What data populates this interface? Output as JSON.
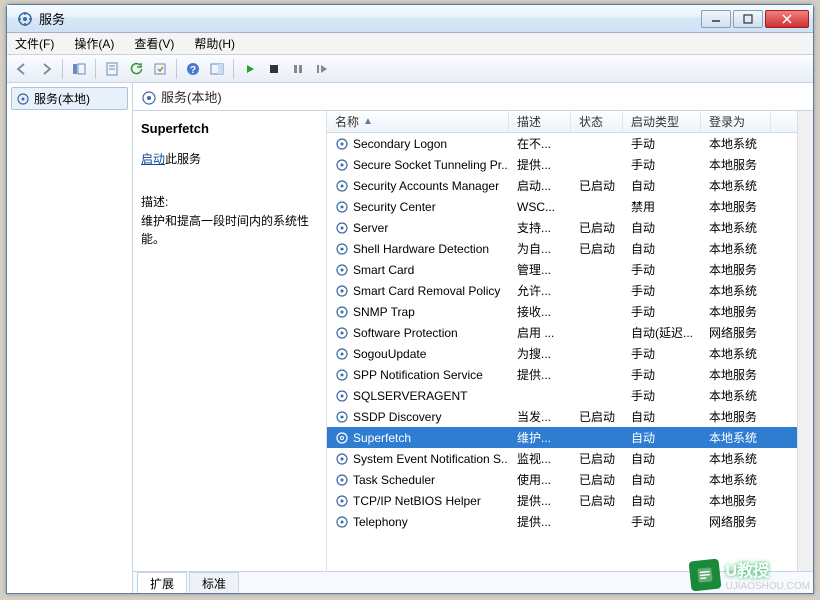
{
  "window": {
    "title": "服务"
  },
  "menu": {
    "file": "文件(F)",
    "action": "操作(A)",
    "view": "查看(V)",
    "help": "帮助(H)"
  },
  "tree": {
    "root": "服务(本地)"
  },
  "panel": {
    "title": "服务(本地)"
  },
  "detail": {
    "name": "Superfetch",
    "start_link": "启动",
    "start_suffix": "此服务",
    "desc_label": "描述:",
    "desc_text": "维护和提高一段时间内的系统性能。"
  },
  "columns": {
    "name": "名称",
    "desc": "描述",
    "status": "状态",
    "start": "启动类型",
    "logon": "登录为"
  },
  "tabs": {
    "extended": "扩展",
    "standard": "标准"
  },
  "selected_index": 12,
  "services": [
    {
      "name": "Secondary Logon",
      "desc": "在不...",
      "status": "",
      "start": "手动",
      "logon": "本地系统"
    },
    {
      "name": "Secure Socket Tunneling Pr...",
      "desc": "提供...",
      "status": "",
      "start": "手动",
      "logon": "本地服务"
    },
    {
      "name": "Security Accounts Manager",
      "desc": "启动...",
      "status": "已启动",
      "start": "自动",
      "logon": "本地系统"
    },
    {
      "name": "Security Center",
      "desc": "WSC...",
      "status": "",
      "start": "禁用",
      "logon": "本地服务"
    },
    {
      "name": "Server",
      "desc": "支持...",
      "status": "已启动",
      "start": "自动",
      "logon": "本地系统"
    },
    {
      "name": "Shell Hardware Detection",
      "desc": "为自...",
      "status": "已启动",
      "start": "自动",
      "logon": "本地系统"
    },
    {
      "name": "Smart Card",
      "desc": "管理...",
      "status": "",
      "start": "手动",
      "logon": "本地服务"
    },
    {
      "name": "Smart Card Removal Policy",
      "desc": "允许...",
      "status": "",
      "start": "手动",
      "logon": "本地系统"
    },
    {
      "name": "SNMP Trap",
      "desc": "接收...",
      "status": "",
      "start": "手动",
      "logon": "本地服务"
    },
    {
      "name": "Software Protection",
      "desc": "启用 ...",
      "status": "",
      "start": "自动(延迟...",
      "logon": "网络服务"
    },
    {
      "name": "SogouUpdate",
      "desc": "为搜...",
      "status": "",
      "start": "手动",
      "logon": "本地系统"
    },
    {
      "name": "SPP Notification Service",
      "desc": "提供...",
      "status": "",
      "start": "手动",
      "logon": "本地服务"
    },
    {
      "name": "SQLSERVERAGENT",
      "desc": "",
      "status": "",
      "start": "手动",
      "logon": "本地系统"
    },
    {
      "name": "SSDP Discovery",
      "desc": "当发...",
      "status": "已启动",
      "start": "自动",
      "logon": "本地服务"
    },
    {
      "name": "Superfetch",
      "desc": "维护...",
      "status": "",
      "start": "自动",
      "logon": "本地系统"
    },
    {
      "name": "System Event Notification S...",
      "desc": "监视...",
      "status": "已启动",
      "start": "自动",
      "logon": "本地系统"
    },
    {
      "name": "Task Scheduler",
      "desc": "使用...",
      "status": "已启动",
      "start": "自动",
      "logon": "本地系统"
    },
    {
      "name": "TCP/IP NetBIOS Helper",
      "desc": "提供...",
      "status": "已启动",
      "start": "自动",
      "logon": "本地服务"
    },
    {
      "name": "Telephony",
      "desc": "提供...",
      "status": "",
      "start": "手动",
      "logon": "网络服务"
    }
  ],
  "watermark": {
    "text": "U教授",
    "url": "UJIAOSHOU.COM"
  }
}
